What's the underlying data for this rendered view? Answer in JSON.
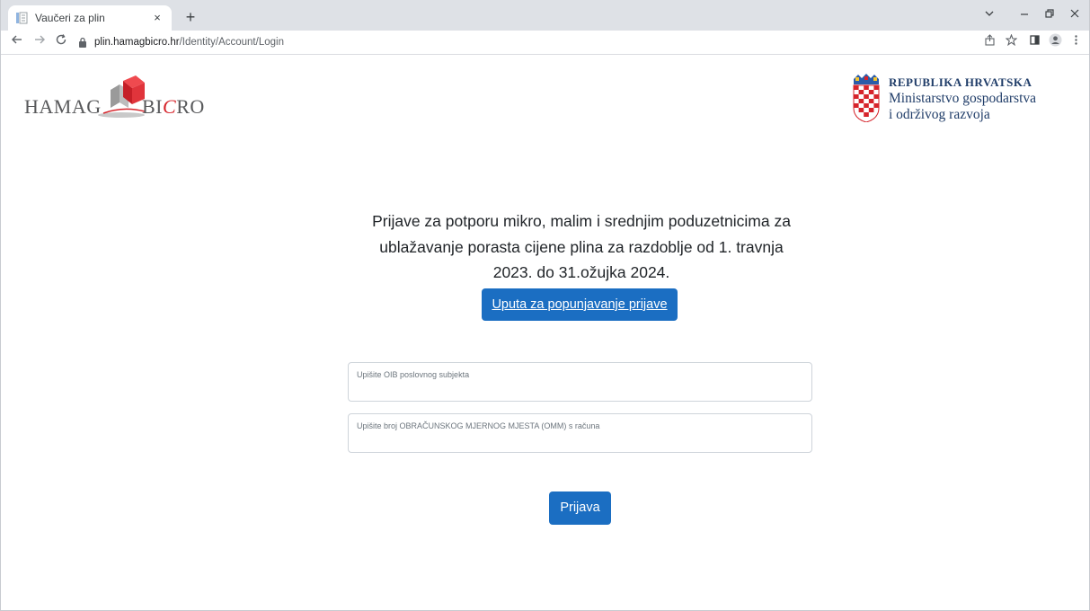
{
  "browser": {
    "tab_title": "Vaučeri za plin",
    "tab_close": "×",
    "new_tab": "+",
    "url_host": "plin.hamagbicro.hr",
    "url_path": "/Identity/Account/Login",
    "icons": {
      "back": "back-arrow-icon",
      "forward": "forward-arrow-icon",
      "reload": "reload-icon",
      "lock": "lock-icon",
      "share": "share-icon",
      "bookmark": "star-icon",
      "sidepanel": "side-panel-icon",
      "profile": "profile-icon",
      "menu": "kebab-menu-icon"
    }
  },
  "header": {
    "hamag_left": "HAMAG",
    "hamag_right_prefix": "BI",
    "hamag_right_accent": "C",
    "hamag_right_suffix": "RO",
    "ministry_title": "REPUBLIKA HRVATSKA",
    "ministry_line1": "Ministarstvo gospodarstva",
    "ministry_line2": "i održivog razvoja"
  },
  "main": {
    "heading_line1": "Prijave za potporu mikro, malim i srednjim poduzetnicima za",
    "heading_line2": "ublažavanje porasta cijene plina za razdoblje od 1. travnja",
    "heading_line3": "2023. do 31.ožujka 2024.",
    "guide_button": "Uputa za popunjavanje prijave",
    "oib_placeholder": "Upišite OIB poslovnog subjekta",
    "omm_placeholder": "Upišite broj OBRAČUNSKOG MJERNOG MJESTA (OMM) s računa",
    "submit_button": "Prijava"
  },
  "colors": {
    "primary": "#1b6ec2",
    "hamag_red": "#d6242b",
    "ministry_blue": "#1f3c68"
  }
}
